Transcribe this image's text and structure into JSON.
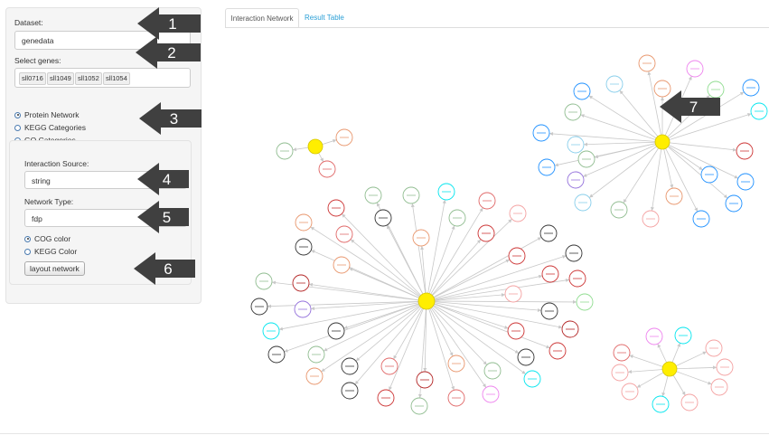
{
  "sidebar": {
    "dataset_label": "Dataset:",
    "dataset_value": "genedata",
    "genes_label": "Select genes:",
    "genes": [
      "sll0716",
      "sll1049",
      "sll1052",
      "sll1054"
    ],
    "network_options": [
      {
        "label": "Protein Network",
        "selected": true
      },
      {
        "label": "KEGG Categories",
        "selected": false
      },
      {
        "label": "GO Categories",
        "selected": false
      }
    ],
    "interaction_source_label": "Interaction Source:",
    "interaction_source_value": "string",
    "network_type_label": "Network Type:",
    "network_type_value": "fdp",
    "color_options": [
      {
        "label": "COG color",
        "selected": true
      },
      {
        "label": "KEGG Color",
        "selected": false
      }
    ],
    "layout_button": "layout network"
  },
  "tabs": [
    "Interaction Network",
    "Result Table"
  ],
  "annotation_numbers": [
    "1",
    "2",
    "3",
    "4",
    "5",
    "6",
    "7"
  ],
  "colors": {
    "hub": "#ffee00",
    "edge": "#c8c8c8",
    "arrow_fill": "#404040",
    "tab_link": "#2a9fd6"
  }
}
